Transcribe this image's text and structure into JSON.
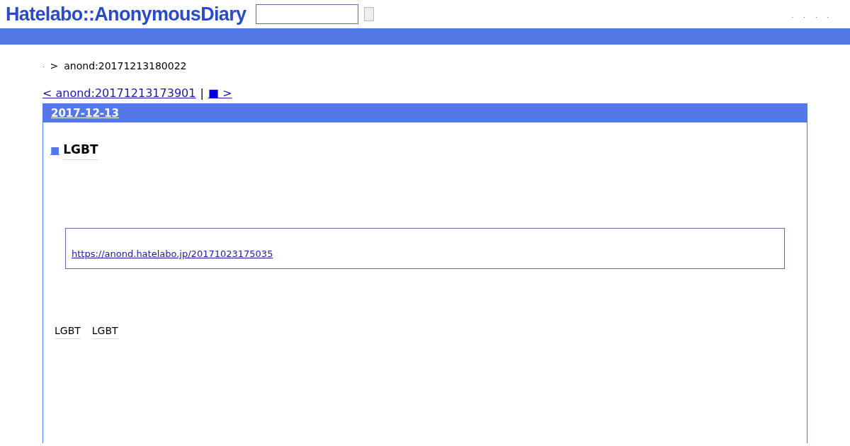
{
  "header": {
    "logo": "Hatelabo::AnonymousDiary",
    "nav_links": [
      ".",
      ".",
      ".",
      "."
    ]
  },
  "breadcrumb": {
    "home": ".",
    "separator": ">",
    "current": "anond:20171213180022"
  },
  "pager": {
    "prev": "< anond:20171213173901",
    "divider": "|",
    "next_icon": "■",
    "next": ">"
  },
  "entry": {
    "date": "2017-12-13",
    "title_icon": "■",
    "title": "LGBT",
    "quote_link": "https://anond.hatelabo.jp/20171023175035",
    "tags": [
      "LGBT",
      "LGBT"
    ]
  }
}
